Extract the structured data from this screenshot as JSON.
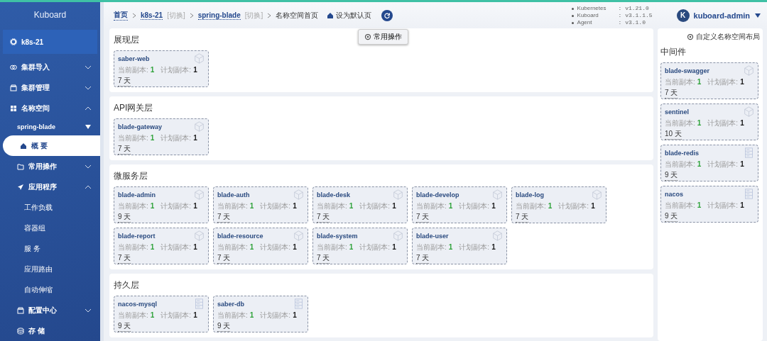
{
  "sidebar": {
    "logo": "Kuboard",
    "items": [
      {
        "kind": "cluster",
        "label": "k8s-21",
        "selected": false
      },
      {
        "kind": "group",
        "label": "集群导入",
        "expanded": false,
        "selected": false
      },
      {
        "kind": "group",
        "label": "集群管理",
        "expanded": false,
        "selected": false
      },
      {
        "kind": "group",
        "label": "名称空间",
        "expanded": true,
        "selected": false
      },
      {
        "kind": "namespace",
        "label": "spring-blade",
        "selected": false
      },
      {
        "kind": "page",
        "label": "概 要",
        "selected": true
      },
      {
        "kind": "group",
        "label": "常用操作",
        "expanded": false,
        "selected": false
      },
      {
        "kind": "group",
        "label": "应用程序",
        "expanded": true,
        "selected": false
      },
      {
        "kind": "child",
        "label": "工作负载",
        "selected": false
      },
      {
        "kind": "child",
        "label": "容器组",
        "selected": false
      },
      {
        "kind": "child",
        "label": "服 务",
        "selected": false
      },
      {
        "kind": "child",
        "label": "应用路由",
        "selected": false
      },
      {
        "kind": "child",
        "label": "自动伸缩",
        "selected": false
      },
      {
        "kind": "group",
        "label": "配置中心",
        "expanded": false,
        "selected": false
      },
      {
        "kind": "page",
        "label": "存 储",
        "selected": false
      }
    ]
  },
  "breadcrumb": {
    "items": [
      {
        "label": "首页"
      },
      {
        "label": "k8s-21",
        "switch": "[切换]"
      },
      {
        "label": "spring-blade",
        "switch": "[切换]"
      },
      {
        "label": "名称空间首页"
      }
    ],
    "set_default": "设为默认页"
  },
  "versions": [
    {
      "name": "Kubernetes",
      "value": ": v1.21.0"
    },
    {
      "name": "Kuboard",
      "value": ": v3.1.1.5"
    },
    {
      "name": "Agent",
      "value": ": v3.1.0"
    }
  ],
  "user": {
    "initial": "K",
    "name": "kuboard-admin"
  },
  "common_ops_button": "常用操作",
  "layers": [
    {
      "title": "展现层",
      "workloads": [
        {
          "kind": "deployment",
          "name": "saber-web",
          "current_label": "当前副本:",
          "current": "1",
          "planned_label": "计划副本:",
          "planned": "1",
          "age": "7 天"
        }
      ]
    },
    {
      "title": "API网关层",
      "workloads": [
        {
          "kind": "deployment",
          "name": "blade-gateway",
          "current_label": "当前副本:",
          "current": "1",
          "planned_label": "计划副本:",
          "planned": "1",
          "age": "7 天"
        }
      ]
    },
    {
      "title": "微服务层",
      "workloads": [
        {
          "kind": "deployment",
          "name": "blade-admin",
          "current_label": "当前副本:",
          "current": "1",
          "planned_label": "计划副本:",
          "planned": "1",
          "age": "9 天"
        },
        {
          "kind": "deployment",
          "name": "blade-auth",
          "current_label": "当前副本:",
          "current": "1",
          "planned_label": "计划副本:",
          "planned": "1",
          "age": "7 天"
        },
        {
          "kind": "deployment",
          "name": "blade-desk",
          "current_label": "当前副本:",
          "current": "1",
          "planned_label": "计划副本:",
          "planned": "1",
          "age": "7 天"
        },
        {
          "kind": "deployment",
          "name": "blade-develop",
          "current_label": "当前副本:",
          "current": "1",
          "planned_label": "计划副本:",
          "planned": "1",
          "age": "7 天"
        },
        {
          "kind": "deployment",
          "name": "blade-log",
          "current_label": "当前副本:",
          "current": "1",
          "planned_label": "计划副本:",
          "planned": "1",
          "age": "7 天"
        },
        {
          "kind": "deployment",
          "name": "blade-report",
          "current_label": "当前副本:",
          "current": "1",
          "planned_label": "计划副本:",
          "planned": "1",
          "age": "7 天"
        },
        {
          "kind": "deployment",
          "name": "blade-resource",
          "current_label": "当前副本:",
          "current": "1",
          "planned_label": "计划副本:",
          "planned": "1",
          "age": "7 天"
        },
        {
          "kind": "deployment",
          "name": "blade-system",
          "current_label": "当前副本:",
          "current": "1",
          "planned_label": "计划副本:",
          "planned": "1",
          "age": "7 天"
        },
        {
          "kind": "deployment",
          "name": "blade-user",
          "current_label": "当前副本:",
          "current": "1",
          "planned_label": "计划副本:",
          "planned": "1",
          "age": "7 天"
        }
      ]
    },
    {
      "title": "持久层",
      "workloads": [
        {
          "kind": "statefulset",
          "name": "nacos-mysql",
          "current_label": "当前副本:",
          "current": "1",
          "planned_label": "计划副本:",
          "planned": "1",
          "age": "9 天"
        },
        {
          "kind": "statefulset",
          "name": "saber-db",
          "current_label": "当前副本:",
          "current": "1",
          "planned_label": "计划副本:",
          "planned": "1",
          "age": "9 天"
        }
      ]
    }
  ],
  "middleware": {
    "title": "中间件",
    "customize": "自定义名称空间布局",
    "workloads": [
      {
        "kind": "deployment",
        "name": "blade-swagger",
        "current_label": "当前副本:",
        "current": "1",
        "planned_label": "计划副本:",
        "planned": "1",
        "age": "7 天"
      },
      {
        "kind": "deployment",
        "name": "sentinel",
        "current_label": "当前副本:",
        "current": "1",
        "planned_label": "计划副本:",
        "planned": "1",
        "age": "10 天"
      },
      {
        "kind": "statefulset",
        "name": "blade-redis",
        "current_label": "当前副本:",
        "current": "1",
        "planned_label": "计划副本:",
        "planned": "1",
        "age": "9 天"
      },
      {
        "kind": "statefulset",
        "name": "nacos",
        "current_label": "当前副本:",
        "current": "1",
        "planned_label": "计划副本:",
        "planned": "1",
        "age": "9 天"
      }
    ]
  }
}
